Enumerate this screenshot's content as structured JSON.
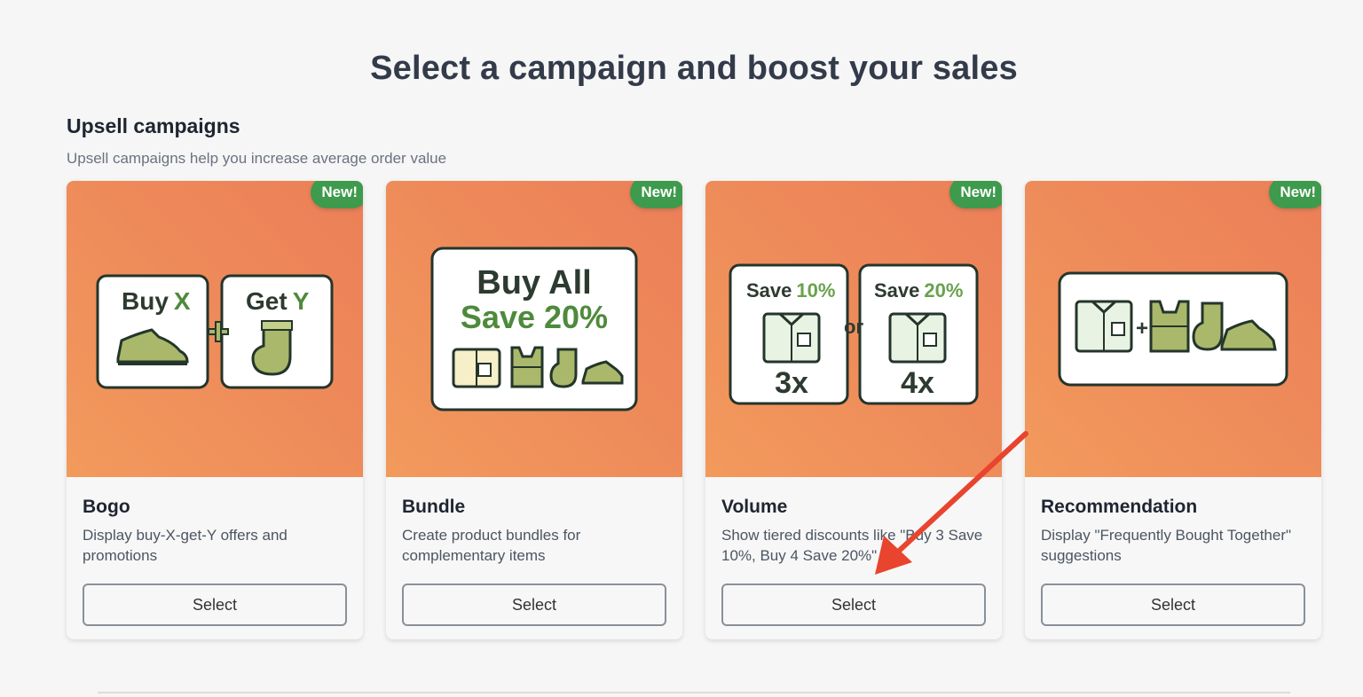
{
  "header": {
    "title": "Select a campaign and boost your sales"
  },
  "section": {
    "title": "Upsell campaigns",
    "description": "Upsell campaigns help you increase average order value"
  },
  "cards": [
    {
      "badge": "New!",
      "title": "Bogo",
      "description": "Display buy-X-get-Y offers and promotions",
      "button": "Select",
      "art": {
        "buy_word": "Buy",
        "buy_letter": "X",
        "get_word": "Get",
        "get_letter": "Y"
      }
    },
    {
      "badge": "New!",
      "title": "Bundle",
      "description": "Create product bundles for complementary items",
      "button": "Select",
      "art": {
        "line1": "Buy All",
        "line2": "Save 20%"
      }
    },
    {
      "badge": "New!",
      "title": "Volume",
      "description": "Show tiered discounts like \"Buy 3 Save 10%, Buy 4 Save 20%\"",
      "button": "Select",
      "art": {
        "left_save": "Save",
        "left_pct": "10%",
        "left_qty": "3x",
        "or": "or",
        "right_save": "Save",
        "right_pct": "20%",
        "right_qty": "4x"
      }
    },
    {
      "badge": "New!",
      "title": "Recommendation",
      "description": "Display \"Frequently Bought Together\" suggestions",
      "button": "Select",
      "art": {
        "plus": "+"
      }
    }
  ],
  "colors": {
    "hero": "#ee8a5a",
    "badge": "#3e9a4c",
    "accent_green": "#4e8a3c",
    "arrow": "#e8442e"
  }
}
